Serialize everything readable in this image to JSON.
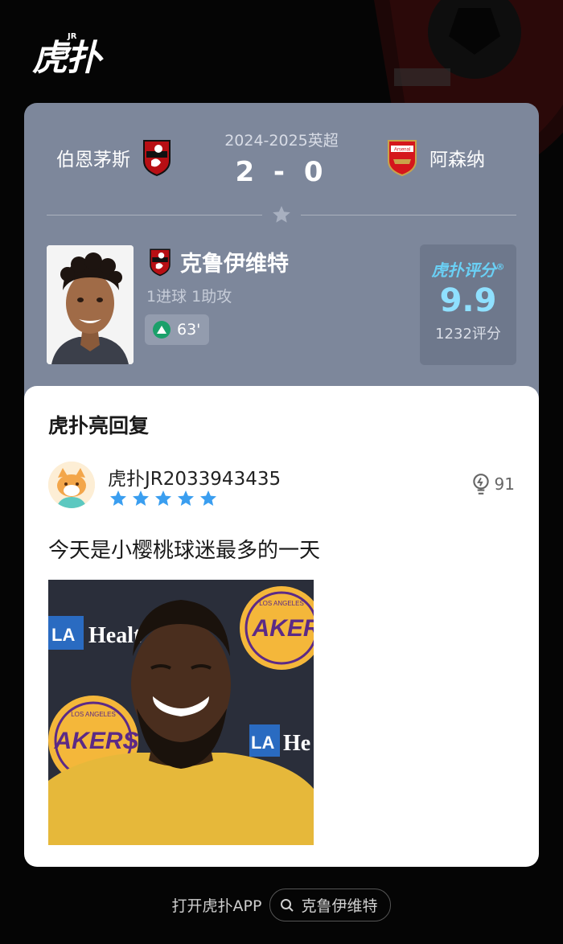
{
  "brand": {
    "logo_text": "虎扑",
    "logo_sup": "JR"
  },
  "match": {
    "season": "2024-2025英超",
    "score": "2 - 0",
    "home_team": "伯恩茅斯",
    "away_team": "阿森纳",
    "away_badge_text": "Arsenal"
  },
  "player": {
    "name": "克鲁伊维特",
    "stats": "1进球 1助攻",
    "minute": "63'",
    "rating_label": "虎扑评分",
    "rating_value": "9.9",
    "rating_count": "1232评分"
  },
  "reply": {
    "heading": "虎扑亮回复",
    "username": "虎扑JR2033943435",
    "stars": 5,
    "likes": "91",
    "text": "今天是小樱桃球迷最多的一天",
    "image_texts": {
      "sponsor": "Healt",
      "sponsor_2": "He",
      "ucla": "LA",
      "ucla_2": "LA",
      "team_logo_top": "LOS ANGELES",
      "team_logo_name": "AKER",
      "team_logo_left_top": "LOS ANGELES",
      "team_logo_left_name": "AKERS"
    }
  },
  "footer": {
    "open_app": "打开虎扑APP",
    "search_label": "克鲁伊维特"
  },
  "colors": {
    "card_bg": "#7d879b",
    "rating_accent": "#8fe0ff",
    "star_blue": "#3a9ef0",
    "minute_green": "#1aa06a"
  }
}
